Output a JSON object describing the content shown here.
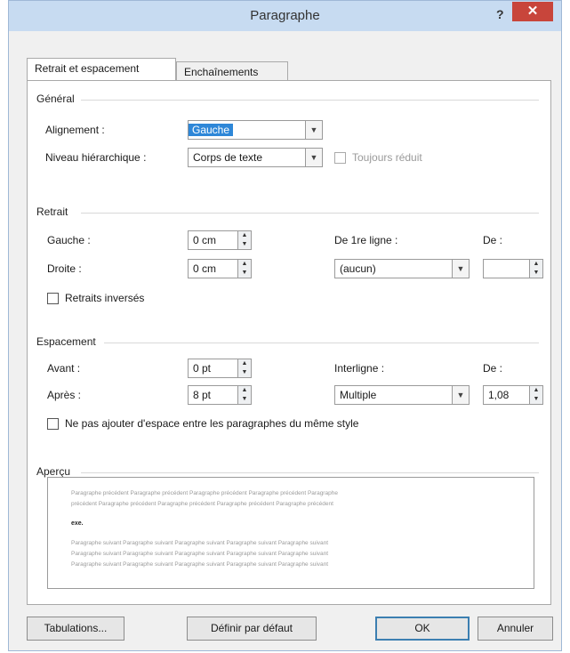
{
  "window": {
    "title": "Paragraphe",
    "help": "?",
    "close": "✕"
  },
  "tabs": [
    {
      "label": "Retrait et espacement",
      "active": true
    },
    {
      "label": "Enchaînements",
      "active": false
    }
  ],
  "general": {
    "section": "Général",
    "alignment_label": "Alignement :",
    "alignment_value": "Gauche",
    "level_label": "Niveau hiérarchique :",
    "level_value": "Corps de texte",
    "collapsed_label": "Toujours réduit"
  },
  "indent": {
    "section": "Retrait",
    "left_label": "Gauche :",
    "left_value": "0 cm",
    "right_label": "Droite :",
    "right_value": "0 cm",
    "first_line_label": "De 1re ligne :",
    "first_line_value": "(aucun)",
    "by_label": "De :",
    "by_value": "",
    "mirror_label": "Retraits inversés"
  },
  "spacing": {
    "section": "Espacement",
    "before_label": "Avant :",
    "before_value": "0 pt",
    "after_label": "Après :",
    "after_value": "8 pt",
    "line_label": "Interligne :",
    "line_value": "Multiple",
    "at_label": "De :",
    "at_value": "1,08",
    "no_space_label": "Ne pas ajouter d'espace entre les paragraphes du même style"
  },
  "preview": {
    "section": "Aperçu",
    "prev_line1": "Paragraphe précédent Paragraphe précédent Paragraphe précédent Paragraphe précédent Paragraphe",
    "prev_line2": "précédent Paragraphe précédent Paragraphe précédent Paragraphe précédent Paragraphe précédent",
    "sample": "exe.",
    "next_line1": "Paragraphe suivant Paragraphe suivant Paragraphe suivant Paragraphe suivant Paragraphe suivant",
    "next_line2": "Paragraphe suivant Paragraphe suivant Paragraphe suivant Paragraphe suivant Paragraphe suivant",
    "next_line3": "Paragraphe suivant Paragraphe suivant Paragraphe suivant Paragraphe suivant Paragraphe suivant"
  },
  "buttons": {
    "tabs": "Tabulations...",
    "default": "Définir par défaut",
    "ok": "OK",
    "cancel": "Annuler"
  },
  "icons": {
    "dropdown": "chevron-down-icon",
    "spinner": "up-down-arrows-icon",
    "close": "close-icon"
  }
}
